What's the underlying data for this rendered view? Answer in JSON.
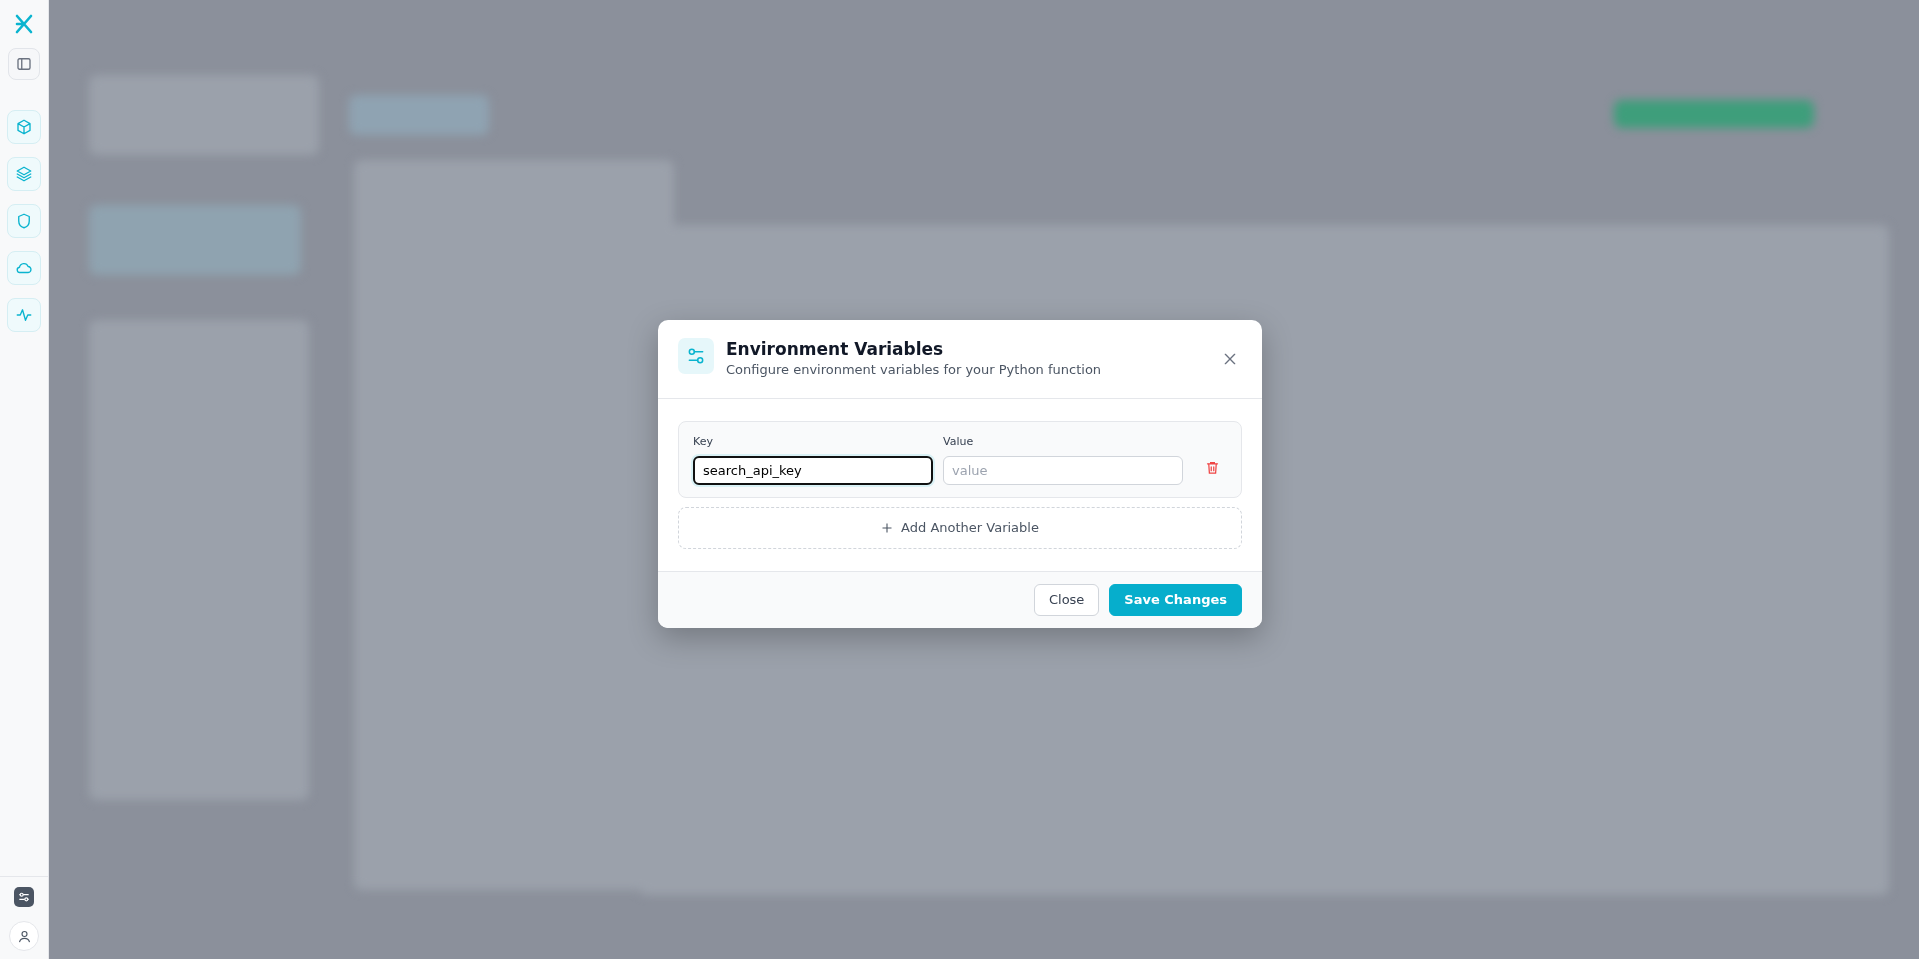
{
  "dialog": {
    "title": "Environment Variables",
    "subtitle": "Configure environment variables for your Python function",
    "variables": [
      {
        "key_label": "Key",
        "value_label": "Value",
        "key": "search_api_key",
        "value_placeholder": "value",
        "key_focused": true
      }
    ],
    "add_button": "Add Another Variable",
    "buttons": [
      {
        "label": "Close",
        "kind": "secondary"
      },
      {
        "label": "Save Changes",
        "kind": "primary"
      }
    ]
  }
}
